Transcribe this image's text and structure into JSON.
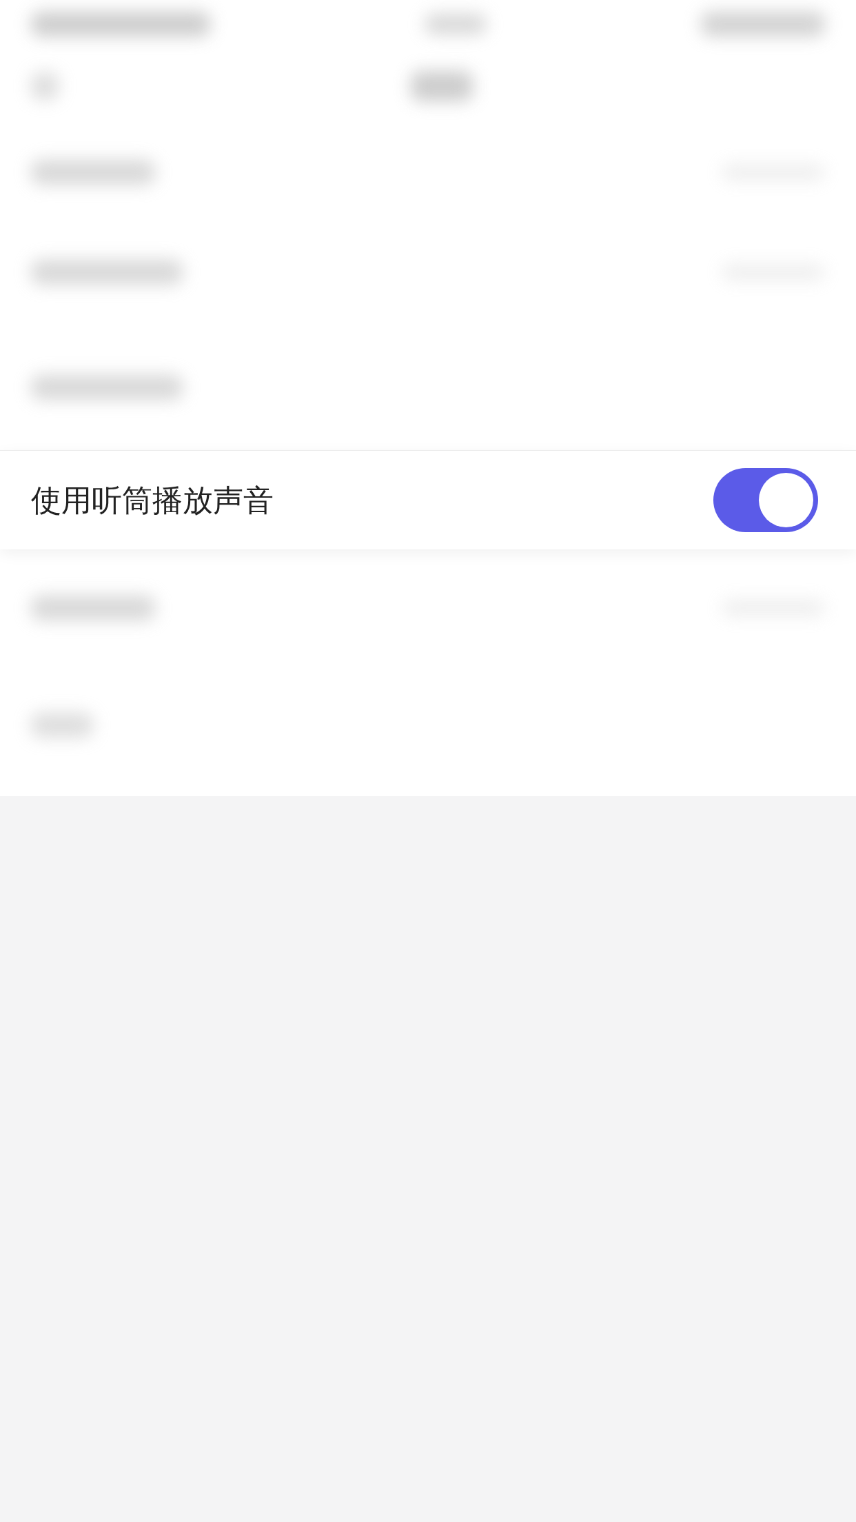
{
  "background": {
    "blurred": true
  },
  "setting": {
    "label": "使用听筒播放声音",
    "on": true
  }
}
